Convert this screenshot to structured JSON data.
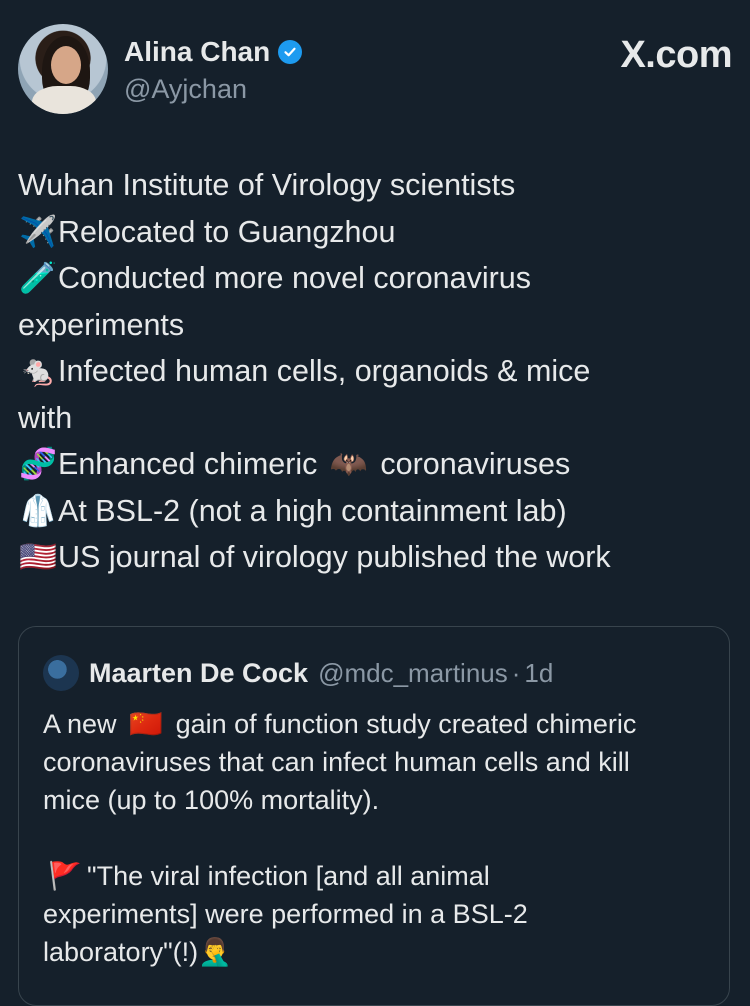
{
  "brand": "X.com",
  "author": {
    "name": "Alina Chan",
    "handle": "@Ayjchan",
    "verified": true
  },
  "tweet": {
    "lines": [
      {
        "emoji": "",
        "text": "Wuhan Institute of Virology scientists"
      },
      {
        "emoji": "✈️",
        "text": "Relocated to Guangzhou"
      },
      {
        "emoji": "🧪",
        "text": "Conducted more novel coronavirus"
      },
      {
        "emoji": "",
        "text": "experiments"
      },
      {
        "emoji": "🐁",
        "text": "Infected human cells, organoids & mice"
      },
      {
        "emoji": "",
        "text": "with"
      },
      {
        "emoji": "🧬",
        "text": "Enhanced chimeric",
        "inline_emoji": "🦇",
        "text_after": "coronaviruses"
      },
      {
        "emoji": "🥼",
        "text": "At BSL-2 (not a high containment lab)"
      },
      {
        "emoji": "🇺🇸",
        "text": "US journal of virology published the work"
      }
    ]
  },
  "quoted": {
    "name": "Maarten De Cock",
    "handle": "@mdc_martinus",
    "separator": "·",
    "time": "1d",
    "p1_a": "A new",
    "p1_flag": "🇨🇳",
    "p1_b": "gain of function study created chimeric",
    "p1_line2": "coronaviruses that can infect human cells and kill",
    "p1_line3": "mice (up to 100% mortality).",
    "p2_flag": "🚩",
    "p2_line1": "\"The viral infection [and all animal",
    "p2_line2": "experiments] were performed in a BSL-2",
    "p2_line3": "laboratory\"(!)",
    "p2_emoji": "🤦‍♂️"
  },
  "colors": {
    "background": "#15202b",
    "text": "#e7e9ea",
    "muted": "#8b98a5",
    "verified": "#1d9bf0",
    "border": "#38444d"
  },
  "icons": {
    "verified": "verified-badge-icon",
    "brand": "x-logo-icon"
  }
}
